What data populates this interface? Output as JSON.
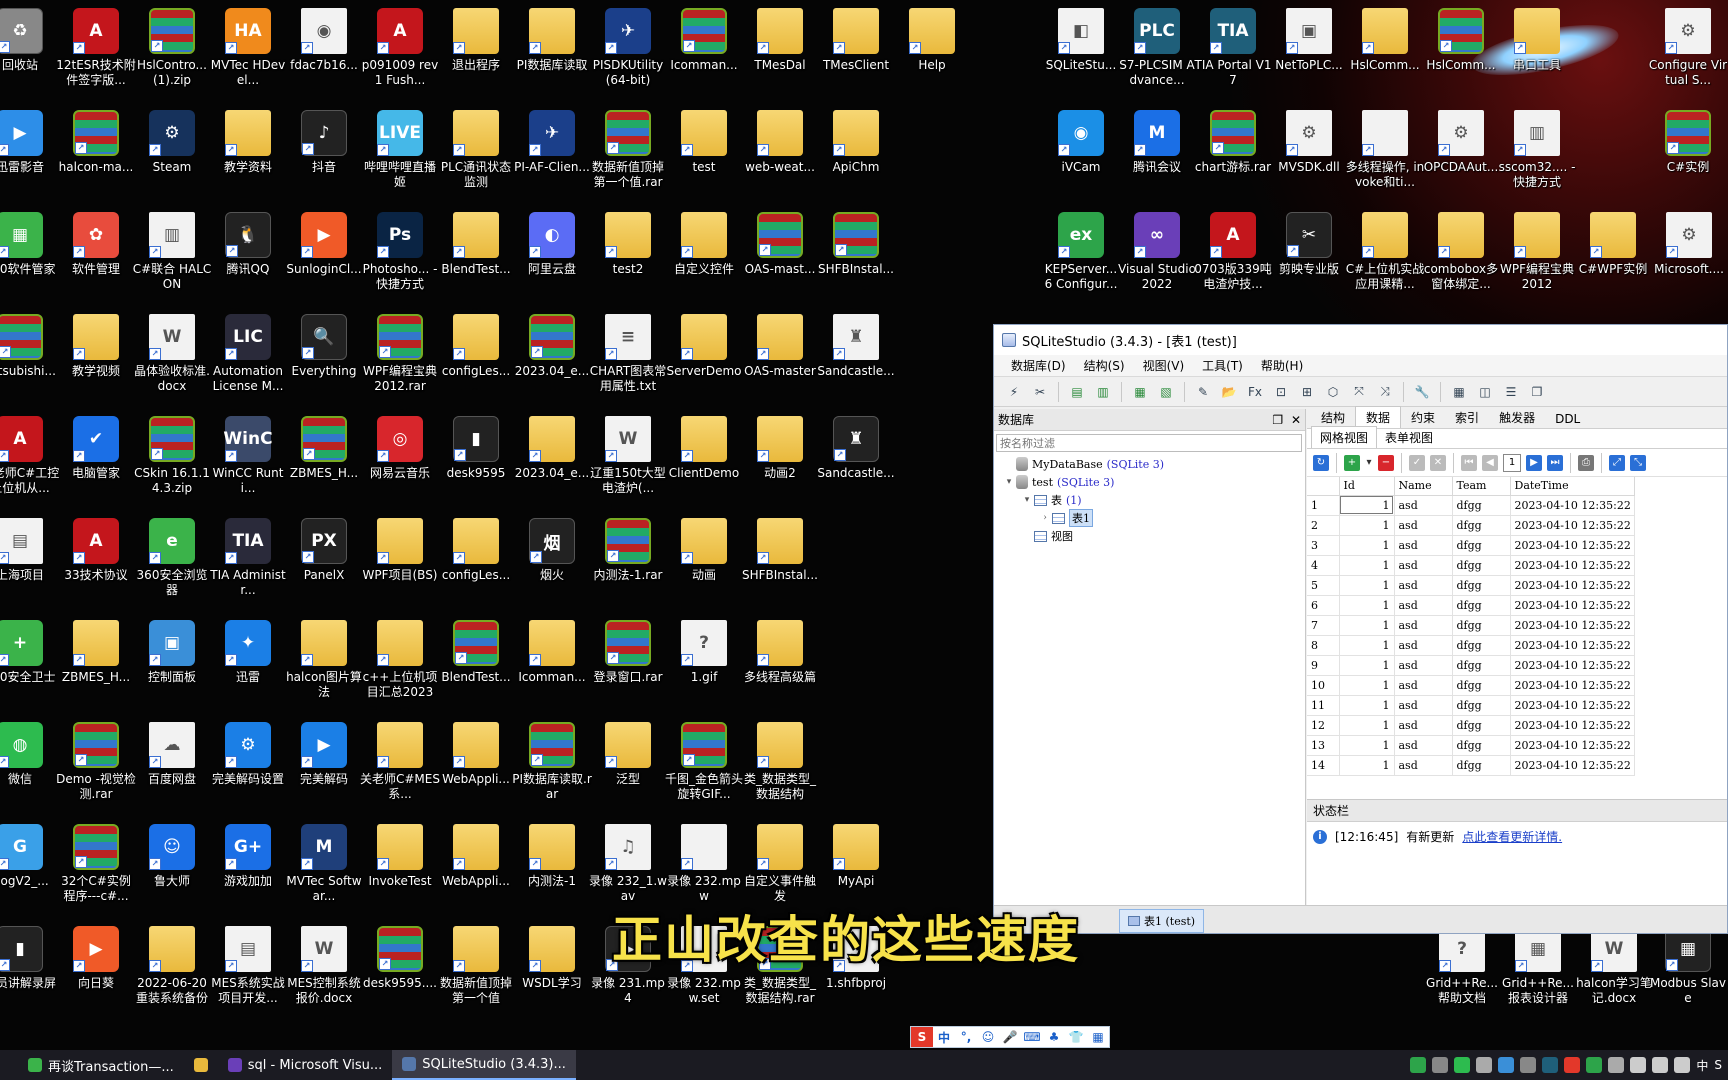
{
  "desktop": {
    "icons": [
      {
        "label": "回收站",
        "kind": "dark",
        "glyph": "♻",
        "color": "#888"
      },
      {
        "label": "12tESR技术附件签字版...",
        "kind": "pdf",
        "glyph": "A"
      },
      {
        "label": "HslContro...(1).zip",
        "kind": "rar",
        "glyph": ""
      },
      {
        "label": "MVTec HDevel...",
        "kind": "app",
        "glyph": "HA",
        "color": "#f08a1c"
      },
      {
        "label": "fdac7b16...",
        "kind": "doc",
        "glyph": "◉"
      },
      {
        "label": "p091009 rev1 Fush...",
        "kind": "pdf",
        "glyph": "A"
      },
      {
        "label": "退出程序",
        "kind": "folder",
        "glyph": ""
      },
      {
        "label": "PI数据库读取",
        "kind": "folder",
        "glyph": ""
      },
      {
        "label": "PISDKUtility (64-bit)",
        "kind": "app",
        "glyph": "✈",
        "color": "#1b3f8a"
      },
      {
        "label": "Icomman...",
        "kind": "rar",
        "glyph": ""
      },
      {
        "label": "TMesDal",
        "kind": "folder",
        "glyph": ""
      },
      {
        "label": "TMesClient",
        "kind": "folder",
        "glyph": ""
      },
      {
        "label": "Help",
        "kind": "folder",
        "glyph": ""
      },
      {
        "label": "迅雷影音",
        "kind": "app",
        "glyph": "▶",
        "color": "#2d8ee8"
      },
      {
        "label": "halcon-ma...",
        "kind": "rar",
        "glyph": ""
      },
      {
        "label": "Steam",
        "kind": "app",
        "glyph": "⚙",
        "color": "#16325c"
      },
      {
        "label": "教学资料",
        "kind": "folder",
        "glyph": ""
      },
      {
        "label": "抖音",
        "kind": "dark",
        "glyph": "♪"
      },
      {
        "label": "哔哩哔哩直播姬",
        "kind": "app",
        "glyph": "LIVE",
        "color": "#45b8e8"
      },
      {
        "label": "PLC通讯状态监测",
        "kind": "folder",
        "glyph": ""
      },
      {
        "label": "PI-AF-Clien...",
        "kind": "app",
        "glyph": "✈",
        "color": "#1b3f8a"
      },
      {
        "label": "数据新值顶掉第一个值.rar",
        "kind": "rar",
        "glyph": ""
      },
      {
        "label": "test",
        "kind": "folder",
        "glyph": ""
      },
      {
        "label": "web-weat...",
        "kind": "folder",
        "glyph": ""
      },
      {
        "label": "ApiChm",
        "kind": "folder",
        "glyph": ""
      },
      {
        "label": "360软件管家",
        "kind": "app",
        "glyph": "▦",
        "color": "#3bb34a"
      },
      {
        "label": "软件管理",
        "kind": "app",
        "glyph": "✿",
        "color": "#e84c3d"
      },
      {
        "label": "C#联合 HALCON",
        "kind": "doc",
        "glyph": "▥"
      },
      {
        "label": "腾讯QQ",
        "kind": "dark",
        "glyph": "🐧"
      },
      {
        "label": "SunloginCl...",
        "kind": "app",
        "glyph": "▶",
        "color": "#f05a28"
      },
      {
        "label": "Photosho... - 快捷方式",
        "kind": "app",
        "glyph": "Ps",
        "color": "#0a2444"
      },
      {
        "label": "BlendTest...",
        "kind": "folder",
        "glyph": ""
      },
      {
        "label": "阿里云盘",
        "kind": "app",
        "glyph": "◐",
        "color": "#5b6cf5"
      },
      {
        "label": "test2",
        "kind": "folder",
        "glyph": ""
      },
      {
        "label": "自定义控件",
        "kind": "folder",
        "glyph": ""
      },
      {
        "label": "OAS-mast...",
        "kind": "rar",
        "glyph": ""
      },
      {
        "label": "SHFBInstal...",
        "kind": "rar",
        "glyph": ""
      },
      {
        "label": "Mitsubishi...",
        "kind": "rar",
        "glyph": ""
      },
      {
        "label": "教学视频",
        "kind": "folder",
        "glyph": ""
      },
      {
        "label": "晶体验收标准.docx",
        "kind": "doc",
        "glyph": "W"
      },
      {
        "label": "Automation License M...",
        "kind": "app",
        "glyph": "LIC",
        "color": "#2a2a3a"
      },
      {
        "label": "Everything",
        "kind": "dark",
        "glyph": "🔍"
      },
      {
        "label": "WPF编程宝典2012.rar",
        "kind": "rar",
        "glyph": ""
      },
      {
        "label": "configLes...",
        "kind": "folder",
        "glyph": ""
      },
      {
        "label": "2023.04_e...",
        "kind": "rar",
        "glyph": ""
      },
      {
        "label": "CHART图表常用属性.txt",
        "kind": "doc",
        "glyph": "≡"
      },
      {
        "label": "ServerDemo",
        "kind": "folder",
        "glyph": ""
      },
      {
        "label": "OAS-master",
        "kind": "folder",
        "glyph": ""
      },
      {
        "label": "Sandcastle...",
        "kind": "doc",
        "glyph": "♜"
      },
      {
        "label": "张老师C#工控上位机从...",
        "kind": "pdf",
        "glyph": "A"
      },
      {
        "label": "电脑管家",
        "kind": "app",
        "glyph": "✔",
        "color": "#1b6fe6"
      },
      {
        "label": "CSkin 16.1.14.3.zip",
        "kind": "rar",
        "glyph": ""
      },
      {
        "label": "WinCC Runti...",
        "kind": "app",
        "glyph": "WinC",
        "color": "#3b4a6a"
      },
      {
        "label": "ZBMES_H...",
        "kind": "rar",
        "glyph": ""
      },
      {
        "label": "网易云音乐",
        "kind": "app",
        "glyph": "◎",
        "color": "#d8262c"
      },
      {
        "label": "desk9595",
        "kind": "dark",
        "glyph": "▮"
      },
      {
        "label": "2023.04_e...",
        "kind": "folder",
        "glyph": ""
      },
      {
        "label": "辽重150t大型电渣炉(...",
        "kind": "doc",
        "glyph": "W"
      },
      {
        "label": "ClientDemo",
        "kind": "folder",
        "glyph": ""
      },
      {
        "label": "动画2",
        "kind": "folder",
        "glyph": ""
      },
      {
        "label": "Sandcastle...",
        "kind": "dark",
        "glyph": "♜"
      },
      {
        "label": "上海项目",
        "kind": "doc",
        "glyph": "▤"
      },
      {
        "label": "33技术协议",
        "kind": "pdf",
        "glyph": "A"
      },
      {
        "label": "360安全浏览器",
        "kind": "app",
        "glyph": "e",
        "color": "#3bb34a"
      },
      {
        "label": "TIA Administr...",
        "kind": "app",
        "glyph": "TIA",
        "color": "#2a2a3a"
      },
      {
        "label": "PanelX",
        "kind": "dark",
        "glyph": "PX"
      },
      {
        "label": "WPF项目(BS)",
        "kind": "folder",
        "glyph": ""
      },
      {
        "label": "configLes...",
        "kind": "folder",
        "glyph": ""
      },
      {
        "label": "烟火",
        "kind": "dark",
        "glyph": "烟"
      },
      {
        "label": "内测法-1.rar",
        "kind": "rar",
        "glyph": ""
      },
      {
        "label": "动画",
        "kind": "folder",
        "glyph": ""
      },
      {
        "label": "SHFBInstal...",
        "kind": "folder",
        "glyph": ""
      },
      {
        "label": "360安全卫士",
        "kind": "app",
        "glyph": "+",
        "color": "#3bb34a"
      },
      {
        "label": "ZBMES_H...",
        "kind": "folder",
        "glyph": ""
      },
      {
        "label": "控制面板",
        "kind": "app",
        "glyph": "▣",
        "color": "#3a8fd8"
      },
      {
        "label": "迅雷",
        "kind": "app",
        "glyph": "✦",
        "color": "#1b7fe6"
      },
      {
        "label": "halcon图片算法",
        "kind": "folder",
        "glyph": ""
      },
      {
        "label": "c++上位机项目汇总2023",
        "kind": "folder",
        "glyph": ""
      },
      {
        "label": "BlendTest...",
        "kind": "rar",
        "glyph": ""
      },
      {
        "label": "Icomman...",
        "kind": "folder",
        "glyph": ""
      },
      {
        "label": "登录窗口.rar",
        "kind": "rar",
        "glyph": ""
      },
      {
        "label": "1.gif",
        "kind": "doc",
        "glyph": "?"
      },
      {
        "label": "多线程高级篇",
        "kind": "folder",
        "glyph": ""
      },
      {
        "label": "微信",
        "kind": "app",
        "glyph": "◍",
        "color": "#2dbb4f"
      },
      {
        "label": "Demo -视觉检测.rar",
        "kind": "rar",
        "glyph": ""
      },
      {
        "label": "百度网盘",
        "kind": "doc",
        "glyph": "☁"
      },
      {
        "label": "完美解码设置",
        "kind": "app",
        "glyph": "⚙",
        "color": "#1b7fe6"
      },
      {
        "label": "完美解码",
        "kind": "app",
        "glyph": "▶",
        "color": "#1b7fe6"
      },
      {
        "label": "关老师C#MES系...",
        "kind": "folder",
        "glyph": ""
      },
      {
        "label": "WebAppli...",
        "kind": "folder",
        "glyph": ""
      },
      {
        "label": "PI数据库读取.rar",
        "kind": "rar",
        "glyph": ""
      },
      {
        "label": "泛型",
        "kind": "folder",
        "glyph": ""
      },
      {
        "label": "千图_金色箭头旋转GIF...",
        "kind": "rar",
        "glyph": ""
      },
      {
        "label": "类_数据类型_数据结构",
        "kind": "folder",
        "glyph": ""
      },
      {
        "label": "DogV2_...",
        "kind": "app",
        "glyph": "G",
        "color": "#3aa0e8"
      },
      {
        "label": "32个C#实例程序---c#...",
        "kind": "rar",
        "glyph": ""
      },
      {
        "label": "鲁大师",
        "kind": "app",
        "glyph": "☺",
        "color": "#1b6fe6"
      },
      {
        "label": "游戏加加",
        "kind": "app",
        "glyph": "G+",
        "color": "#1b6fe6"
      },
      {
        "label": "MVTec Softwar...",
        "kind": "app",
        "glyph": "M",
        "color": "#1f3f7a"
      },
      {
        "label": "InvokeTest",
        "kind": "folder",
        "glyph": ""
      },
      {
        "label": "WebAppli...",
        "kind": "folder",
        "glyph": ""
      },
      {
        "label": "内测法-1",
        "kind": "folder",
        "glyph": ""
      },
      {
        "label": "录像 232_1.wav",
        "kind": "doc",
        "glyph": "♫"
      },
      {
        "label": "录像 232.mpw",
        "kind": "doc",
        "glyph": ""
      },
      {
        "label": "自定义事件触发",
        "kind": "folder",
        "glyph": ""
      },
      {
        "label": "MyApi",
        "kind": "folder",
        "glyph": ""
      },
      {
        "label": "学员讲解录屏",
        "kind": "dark",
        "glyph": "▮"
      },
      {
        "label": "向日葵",
        "kind": "app",
        "glyph": "▶",
        "color": "#f05a28"
      },
      {
        "label": "2022-06-20重装系统备份",
        "kind": "folder",
        "glyph": ""
      },
      {
        "label": "MES系统实战项目开发...",
        "kind": "doc",
        "glyph": "▤"
      },
      {
        "label": "MES控制系统报价.docx",
        "kind": "doc",
        "glyph": "W"
      },
      {
        "label": "desk9595....",
        "kind": "rar",
        "glyph": ""
      },
      {
        "label": "数据新值顶掉第一个值",
        "kind": "folder",
        "glyph": ""
      },
      {
        "label": "WSDL学习",
        "kind": "folder",
        "glyph": ""
      },
      {
        "label": "录像 231.mp4",
        "kind": "dark",
        "glyph": "▶"
      },
      {
        "label": "录像 232.mpw.set",
        "kind": "doc",
        "glyph": ""
      },
      {
        "label": "类_数据类型_数据结构.rar",
        "kind": "rar",
        "glyph": ""
      },
      {
        "label": "1.shfbproj",
        "kind": "doc",
        "glyph": ""
      },
      {
        "label": "SQLiteStu...",
        "kind": "doc",
        "glyph": "◧"
      },
      {
        "label": "S7-PLCSIM Advance...",
        "kind": "app",
        "glyph": "PLC",
        "color": "#1f5f7a"
      },
      {
        "label": "TIA Portal V17",
        "kind": "app",
        "glyph": "TIA",
        "color": "#1f5f7a"
      },
      {
        "label": "NetToPLC...",
        "kind": "doc",
        "glyph": "▣"
      },
      {
        "label": "HslComm...",
        "kind": "folder",
        "glyph": ""
      },
      {
        "label": "HslComm...",
        "kind": "rar",
        "glyph": ""
      },
      {
        "label": "串口工具",
        "kind": "folder",
        "glyph": ""
      },
      {
        "label": "Configure Virtual S...",
        "kind": "doc",
        "glyph": "⚙"
      },
      {
        "label": "iVCam",
        "kind": "app",
        "glyph": "◉",
        "color": "#1b8fe6"
      },
      {
        "label": "腾讯会议",
        "kind": "app",
        "glyph": "M",
        "color": "#1b6fe6"
      },
      {
        "label": "chart游标.rar",
        "kind": "rar",
        "glyph": ""
      },
      {
        "label": "MVSDK.dll",
        "kind": "doc",
        "glyph": "⚙"
      },
      {
        "label": "多线程操作, invoke和ti...",
        "kind": "doc",
        "glyph": ""
      },
      {
        "label": "OPCDAAut...",
        "kind": "doc",
        "glyph": "⚙"
      },
      {
        "label": "sscom32.... - 快捷方式",
        "kind": "doc",
        "glyph": "▥"
      },
      {
        "label": "C#实例",
        "kind": "rar",
        "glyph": ""
      },
      {
        "label": "KEPServer... 6 Configur...",
        "kind": "app",
        "glyph": "ex",
        "color": "#2da44a"
      },
      {
        "label": "Visual Studio 2022",
        "kind": "app",
        "glyph": "∞",
        "color": "#6a3fb8"
      },
      {
        "label": "0703版339吨电渣炉技...",
        "kind": "pdf",
        "glyph": "A"
      },
      {
        "label": "剪映专业版",
        "kind": "dark",
        "glyph": "✂"
      },
      {
        "label": "C#上位机实战应用课精...",
        "kind": "folder",
        "glyph": ""
      },
      {
        "label": "combobox多窗体绑定...",
        "kind": "folder",
        "glyph": ""
      },
      {
        "label": "WPF编程宝典2012",
        "kind": "folder",
        "glyph": ""
      },
      {
        "label": "C#WPF实例",
        "kind": "folder",
        "glyph": ""
      },
      {
        "label": "Microsoft....",
        "kind": "doc",
        "glyph": "⚙"
      },
      {
        "label": "Grid++Re...帮助文档",
        "kind": "doc",
        "glyph": "?"
      },
      {
        "label": "Grid++Re...报表设计器",
        "kind": "doc",
        "glyph": "▦"
      },
      {
        "label": "halcon学习笔记.docx",
        "kind": "doc",
        "glyph": "W"
      },
      {
        "label": "Modbus Slave",
        "kind": "dark",
        "glyph": "▦"
      }
    ]
  },
  "sqlite": {
    "title": "SQLiteStudio (3.4.3) - [表1 (test)]",
    "menu": [
      "数据库(D)",
      "结构(S)",
      "视图(V)",
      "工具(T)",
      "帮助(H)"
    ],
    "db_panel": {
      "title": "数据库",
      "filter_placeholder": "按名称过滤",
      "tree": [
        {
          "label": "MyDataBase",
          "sub": "(SQLite 3)",
          "level": 0,
          "kind": "db",
          "toggle": ""
        },
        {
          "label": "test",
          "sub": "(SQLite 3)",
          "level": 0,
          "kind": "db",
          "toggle": "▾"
        },
        {
          "label": "表",
          "sub": "(1)",
          "level": 1,
          "kind": "tables",
          "toggle": "▾"
        },
        {
          "label": "表1",
          "sub": "",
          "level": 2,
          "kind": "table",
          "toggle": "›",
          "selected": true
        },
        {
          "label": "视图",
          "sub": "",
          "level": 1,
          "kind": "views",
          "toggle": ""
        }
      ]
    },
    "tabs": [
      "结构",
      "数据",
      "约束",
      "索引",
      "触发器",
      "DDL"
    ],
    "active_tab": "数据",
    "subtabs": [
      "网格视图",
      "表单视图"
    ],
    "page_number": "1",
    "grid": {
      "columns": [
        "Id",
        "Name",
        "Team",
        "DateTime"
      ],
      "rows": [
        {
          "n": "1",
          "id": "1",
          "name": "asd",
          "team": "dfgg",
          "dt": "2023-04-10 12:35:22"
        },
        {
          "n": "2",
          "id": "1",
          "name": "asd",
          "team": "dfgg",
          "dt": "2023-04-10 12:35:22"
        },
        {
          "n": "3",
          "id": "1",
          "name": "asd",
          "team": "dfgg",
          "dt": "2023-04-10 12:35:22"
        },
        {
          "n": "4",
          "id": "1",
          "name": "asd",
          "team": "dfgg",
          "dt": "2023-04-10 12:35:22"
        },
        {
          "n": "5",
          "id": "1",
          "name": "asd",
          "team": "dfgg",
          "dt": "2023-04-10 12:35:22"
        },
        {
          "n": "6",
          "id": "1",
          "name": "asd",
          "team": "dfgg",
          "dt": "2023-04-10 12:35:22"
        },
        {
          "n": "7",
          "id": "1",
          "name": "asd",
          "team": "dfgg",
          "dt": "2023-04-10 12:35:22"
        },
        {
          "n": "8",
          "id": "1",
          "name": "asd",
          "team": "dfgg",
          "dt": "2023-04-10 12:35:22"
        },
        {
          "n": "9",
          "id": "1",
          "name": "asd",
          "team": "dfgg",
          "dt": "2023-04-10 12:35:22"
        },
        {
          "n": "10",
          "id": "1",
          "name": "asd",
          "team": "dfgg",
          "dt": "2023-04-10 12:35:22"
        },
        {
          "n": "11",
          "id": "1",
          "name": "asd",
          "team": "dfgg",
          "dt": "2023-04-10 12:35:22"
        },
        {
          "n": "12",
          "id": "1",
          "name": "asd",
          "team": "dfgg",
          "dt": "2023-04-10 12:35:22"
        },
        {
          "n": "13",
          "id": "1",
          "name": "asd",
          "team": "dfgg",
          "dt": "2023-04-10 12:35:22"
        },
        {
          "n": "14",
          "id": "1",
          "name": "asd",
          "team": "dfgg",
          "dt": "2023-04-10 12:35:22"
        }
      ]
    },
    "status": {
      "title": "状态栏",
      "time": "[12:16:45]",
      "message": "有新更新",
      "link": "点此查看更新详情."
    },
    "window_tab": "表1 (test)"
  },
  "subtitle": "正山改查的这些速度",
  "ime": {
    "items": [
      "S",
      "中",
      "°,",
      "☺",
      "🎤",
      "⌨",
      "♣",
      "👕",
      "▦"
    ]
  },
  "taskbar": {
    "tasks": [
      {
        "label": "再谈Transaction—...",
        "color": "#3bb34a"
      },
      {
        "label": "",
        "color": "#e9b93c"
      },
      {
        "label": "sql - Microsoft Visu...",
        "color": "#6a3fb8"
      },
      {
        "label": "SQLiteStudio (3.4.3)...",
        "color": "#5577aa",
        "active": true
      }
    ],
    "tray_text": [
      "中",
      "S"
    ],
    "tray_icons": [
      "#2da44a",
      "#888",
      "#2dbb4f",
      "#aaa",
      "#3a8fd8",
      "#888",
      "#1f5f7a",
      "#e3382a",
      "#2da44a",
      "#aaa",
      "#ccc",
      "#ccc",
      "#ccc"
    ]
  }
}
